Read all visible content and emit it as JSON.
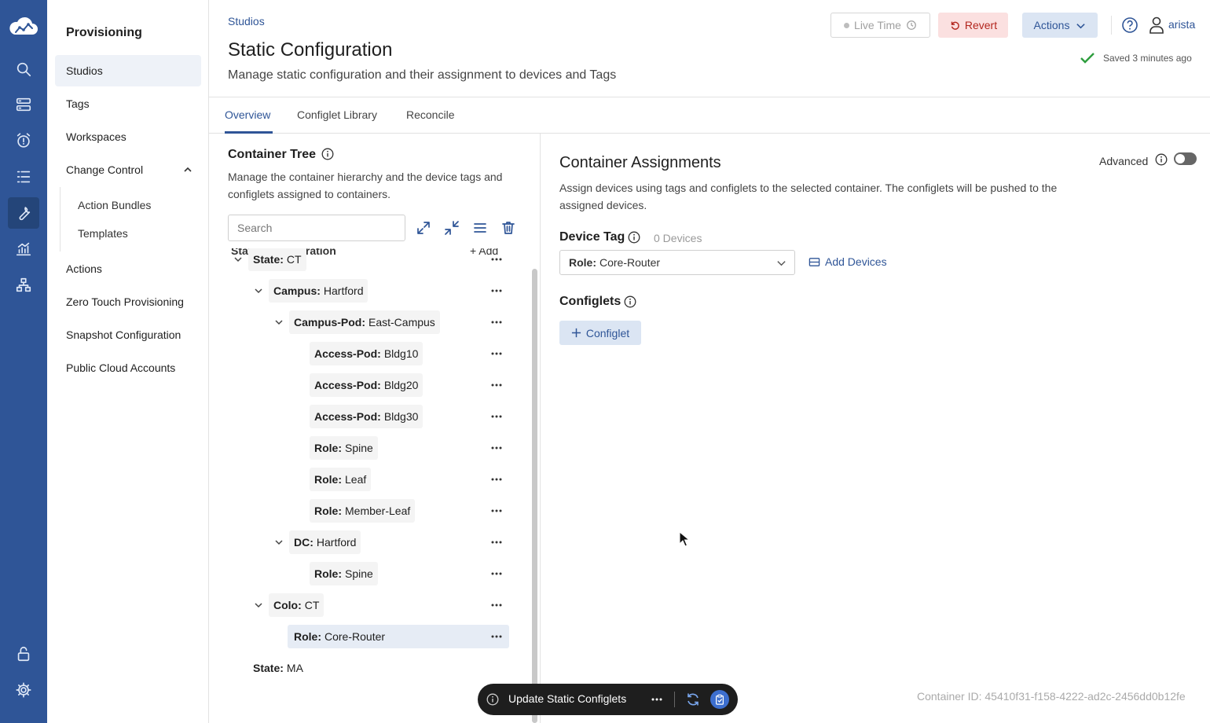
{
  "rail": {
    "items": [
      {
        "icon": "cloud-logo-icon"
      },
      {
        "icon": "search-icon"
      },
      {
        "icon": "devices-icon"
      },
      {
        "icon": "alarm-icon"
      },
      {
        "icon": "tasks-icon"
      },
      {
        "icon": "wrench-icon",
        "active": true
      },
      {
        "icon": "analytics-icon"
      },
      {
        "icon": "topology-icon"
      },
      {
        "icon": "unlock-icon"
      },
      {
        "icon": "gear-icon"
      }
    ]
  },
  "subnav": {
    "title": "Provisioning",
    "items": {
      "studios": "Studios",
      "tags": "Tags",
      "workspaces": "Workspaces",
      "change_control": "Change Control",
      "action_bundles": "Action Bundles",
      "templates": "Templates",
      "actions": "Actions",
      "ztp": "Zero Touch Provisioning",
      "snapshot": "Snapshot Configuration",
      "public_cloud": "Public Cloud Accounts"
    }
  },
  "header": {
    "breadcrumb": "Studios",
    "title": "Static Configuration",
    "description": "Manage static configuration and their assignment to devices and Tags",
    "live_time": "Live Time",
    "revert": "Revert",
    "actions": "Actions",
    "user": "arista",
    "saved": "Saved 3 minutes ago"
  },
  "tabs": {
    "overview": "Overview",
    "library": "Configlet Library",
    "reconcile": "Reconcile"
  },
  "tree": {
    "title": "Container Tree",
    "description": "Manage the container hierarchy and the device tags and configlets assigned to containers.",
    "search_placeholder": "Search",
    "root_label": "Static Configuration",
    "add_label": "+ Add",
    "rows": [
      {
        "key": "State:",
        "value": "CT"
      },
      {
        "key": "Campus:",
        "value": "Hartford"
      },
      {
        "key": "Campus-Pod:",
        "value": "East-Campus"
      },
      {
        "key": "Access-Pod:",
        "value": "Bldg10"
      },
      {
        "key": "Access-Pod:",
        "value": "Bldg20"
      },
      {
        "key": "Access-Pod:",
        "value": "Bldg30"
      },
      {
        "key": "Role:",
        "value": "Spine"
      },
      {
        "key": "Role:",
        "value": "Leaf"
      },
      {
        "key": "Role:",
        "value": "Member-Leaf"
      },
      {
        "key": "DC:",
        "value": "Hartford"
      },
      {
        "key": "Role:",
        "value": "Spine"
      },
      {
        "key": "Colo:",
        "value": "CT"
      },
      {
        "key": "Role:",
        "value": "Core-Router"
      },
      {
        "key": "State:",
        "value": "MA"
      }
    ]
  },
  "assign": {
    "title": "Container Assignments",
    "description": "Assign devices using tags and configlets to the selected container. The configlets will be pushed to the assigned devices.",
    "advanced": "Advanced",
    "device_tag_label": "Device Tag",
    "device_count": "0 Devices",
    "select_key": "Role:",
    "select_value": "Core-Router",
    "add_devices": "Add Devices",
    "configlets_label": "Configlets",
    "add_configlet": "Configlet",
    "container_id": "Container ID: 45410f31-f158-4222-ad2c-2456dd0b12fe"
  },
  "floatbar": {
    "label": "Update Static Configlets"
  },
  "colors": {
    "rail": "#2f5597",
    "accent": "#2f5597",
    "revert": "#b3261e",
    "success": "#2e9e3e"
  }
}
